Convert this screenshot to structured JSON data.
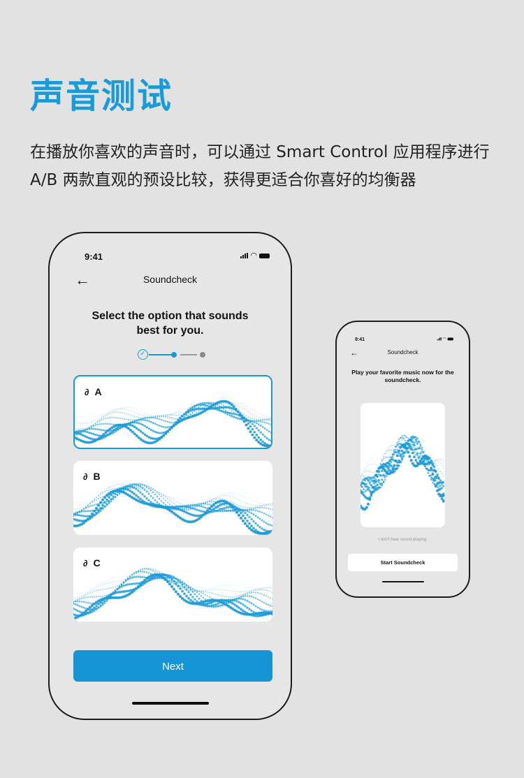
{
  "page": {
    "title": "声音测试",
    "description": "在播放你喜欢的声音时，可以通过 Smart Control 应用程序进行 A/B 两款直观的预设比较，获得更适合你喜好的均衡器"
  },
  "phone1": {
    "status_time": "9:41",
    "nav_title": "Soundcheck",
    "heading": "Select the option that sounds best for you.",
    "step_check": "✓",
    "options": [
      {
        "label": "A",
        "selected": true
      },
      {
        "label": "B",
        "selected": false
      },
      {
        "label": "C",
        "selected": false
      }
    ],
    "next_label": "Next"
  },
  "phone2": {
    "status_time": "9:41",
    "nav_title": "Soundcheck",
    "heading": "Play your favorite music now for the soundcheck.",
    "hint": "I don't hear sound playing.",
    "button_label": "Start Soundcheck"
  },
  "icons": {
    "back": "arrow-left-icon",
    "ear": "ear-icon",
    "wifi": "wifi-icon",
    "signal": "signal-icon",
    "battery": "battery-icon"
  },
  "colors": {
    "accent": "#1a9ad7",
    "button": "#1695d6",
    "background": "#e2e2e2"
  }
}
